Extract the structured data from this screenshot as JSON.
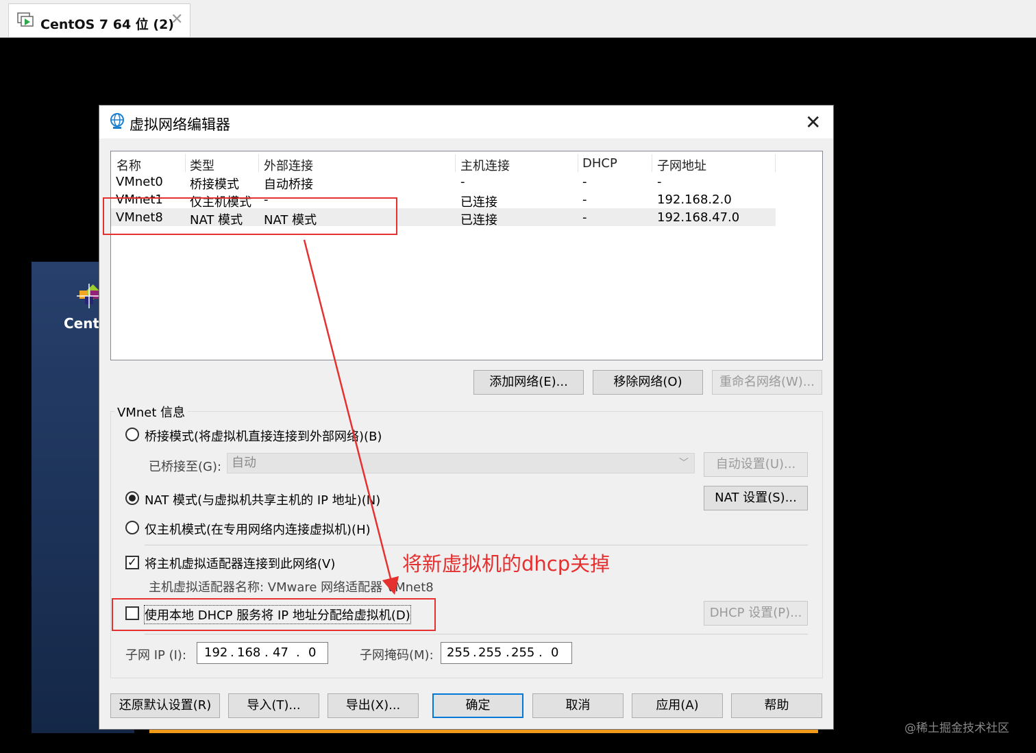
{
  "tab": {
    "title": "CentOS 7 64 位 (2)",
    "close": "✕"
  },
  "background": {
    "logo_text": "Cent(",
    "watermark": "@稀土掘金技术社区"
  },
  "dialog": {
    "title": "虚拟网络编辑器",
    "close": "✕",
    "table": {
      "headers": [
        "名称",
        "类型",
        "外部连接",
        "主机连接",
        "DHCP",
        "子网地址"
      ],
      "rows": [
        [
          "VMnet0",
          "桥接模式",
          "自动桥接",
          "-",
          "-",
          "-"
        ],
        [
          "VMnet1",
          "仅主机模式",
          "-",
          "已连接",
          "-",
          "192.168.2.0"
        ],
        [
          "VMnet8",
          "NAT 模式",
          "NAT 模式",
          "已连接",
          "-",
          "192.168.47.0"
        ]
      ],
      "selected_row": 2
    },
    "buttons": {
      "add": "添加网络(E)...",
      "remove": "移除网络(O)",
      "rename": "重命名网络(W)..."
    },
    "vmnet_info": {
      "label": "VMnet 信息",
      "bridged_radio": "桥接模式(将虚拟机直接连接到外部网络)(B)",
      "bridged_to_label": "已桥接至(G):",
      "bridged_to_value": "自动",
      "auto_settings": "自动设置(U)...",
      "nat_radio": "NAT 模式(与虚拟机共享主机的 IP 地址)(N)",
      "nat_settings": "NAT 设置(S)...",
      "hostonly_radio": "仅主机模式(在专用网络内连接虚拟机)(H)",
      "selected_mode": "nat",
      "connect_adapter": "将主机虚拟适配器连接到此网络(V)",
      "connect_adapter_checked": true,
      "adapter_name": "主机虚拟适配器名称: VMware 网络适配器 VMnet8",
      "use_dhcp": "使用本地 DHCP 服务将 IP 地址分配给虚拟机(D)",
      "use_dhcp_checked": false,
      "dhcp_settings": "DHCP 设置(P)...",
      "subnet_ip_label": "子网 IP (I):",
      "subnet_ip": [
        "192",
        "168",
        "47",
        "0"
      ],
      "subnet_mask_label": "子网掩码(M):",
      "subnet_mask": [
        "255",
        "255",
        "255",
        "0"
      ]
    },
    "footer": {
      "restore": "还原默认设置(R)",
      "import": "导入(T)...",
      "export": "导出(X)...",
      "ok": "确定",
      "cancel": "取消",
      "apply": "应用(A)",
      "help": "帮助"
    }
  },
  "annotation": {
    "text": "将新虚拟机的dhcp关掉",
    "color": "#e53030"
  }
}
